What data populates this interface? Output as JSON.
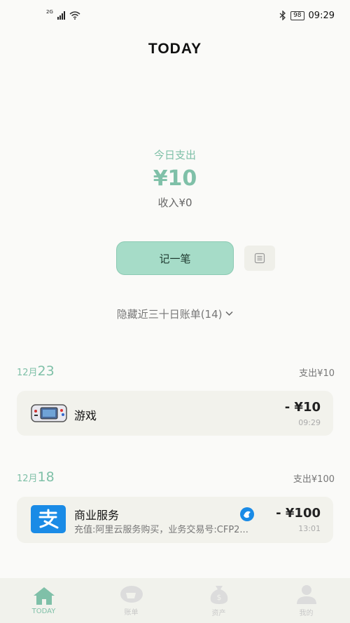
{
  "status_bar": {
    "network": "2G",
    "battery": "98",
    "time": "09:29"
  },
  "app_title": "TODAY",
  "summary": {
    "label": "今日支出",
    "amount": "¥10",
    "income": "收入¥0"
  },
  "record_button_label": "记一笔",
  "hidden_bills_text": "隐藏近三十日账单(14)",
  "days": [
    {
      "month": "12月",
      "day": "23",
      "total": "支出¥10",
      "bills": [
        {
          "name": "游戏",
          "amount": "- ¥10",
          "time": "09:29",
          "icon": "gamepad-icon"
        }
      ]
    },
    {
      "month": "12月",
      "day": "18",
      "total": "支出¥100",
      "bills": [
        {
          "name": "商业服务",
          "amount": "- ¥100",
          "time": "13:01",
          "note": "充值:阿里云服务购买，业务交易号:CFP2...",
          "icon": "alipay-icon",
          "channel_icon": "channel-icon"
        }
      ]
    }
  ],
  "tabs": [
    {
      "label": "TODAY",
      "icon": "home-icon",
      "active": true
    },
    {
      "label": "账单",
      "icon": "bill-icon",
      "active": false
    },
    {
      "label": "资产",
      "icon": "money-bag-icon",
      "active": false
    },
    {
      "label": "我的",
      "icon": "person-icon",
      "active": false
    }
  ],
  "colors": {
    "accent": "#7fc0a8",
    "button": "#a6dcc8",
    "card": "#f2f2ec",
    "alipay": "#1a8be6"
  }
}
